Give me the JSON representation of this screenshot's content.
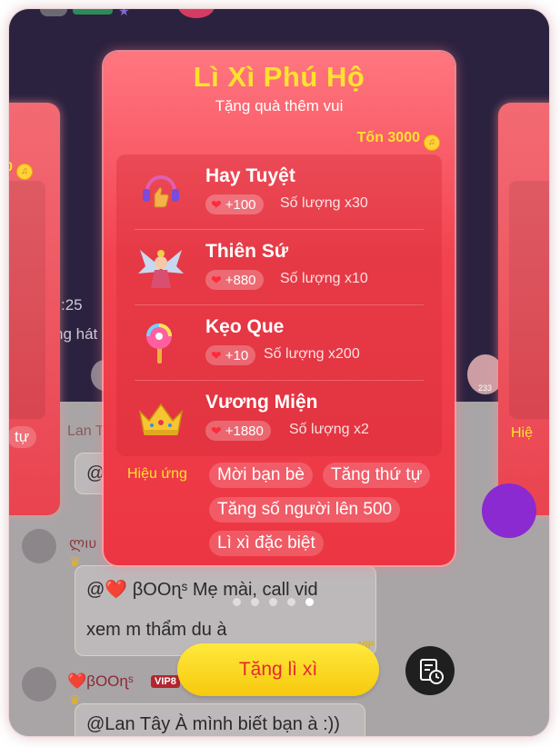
{
  "card": {
    "title": "Lì Xì Phú Hộ",
    "subtitle": "Tặng quà thêm vui",
    "cost_label": "Tốn 3000"
  },
  "gifts": [
    {
      "name": "Hay Tuyệt",
      "points": "+100",
      "quantity": "Số lượng x30",
      "icon": "thumbs-up-headphones-icon"
    },
    {
      "name": "Thiên Sứ",
      "points": "+880",
      "quantity": "Số lượng x10",
      "icon": "angel-icon"
    },
    {
      "name": "Kẹo Que",
      "points": "+10",
      "quantity": "Số lượng x200",
      "icon": "lollipop-icon"
    },
    {
      "name": "Vương Miện",
      "points": "+1880",
      "quantity": "Số lượng x2",
      "icon": "crown-icon"
    }
  ],
  "effects": {
    "label": "Hiệu ứng",
    "chips": [
      "Mời bạn bè",
      "Tăng thứ tự",
      "Tăng số người lên 500",
      "Lì xì đặc biệt"
    ]
  },
  "side_cards": {
    "left_cost": "0",
    "left_tag": "tự",
    "right_tag": "Hiệ"
  },
  "background": {
    "time_fragment": ":25",
    "text_fragment": "ng hát",
    "count_fragment": "233"
  },
  "chat": {
    "messages": [
      {
        "username": "Lan T",
        "text": "@"
      },
      {
        "username": "ლıʋ",
        "text_line1": "@❤️ βOOɳˢ  Mẹ mài, call vid",
        "text_line2": "xem m thẩm du à"
      },
      {
        "username": "❤️βOOɳˢ",
        "badge": "VIP8",
        "text": "@Lan Tây À mình biết bạn à :))"
      }
    ],
    "vip_mark": "VIP"
  },
  "carousel": {
    "total": 5,
    "active": 5
  },
  "actions": {
    "send_label": "Tặng lì xì",
    "history_icon": "gift-history-icon"
  },
  "colors": {
    "card_red": "#f2434f",
    "title_yellow": "#ffe22d",
    "button_yellow": "#ffe93d",
    "button_text": "#e5272f"
  }
}
